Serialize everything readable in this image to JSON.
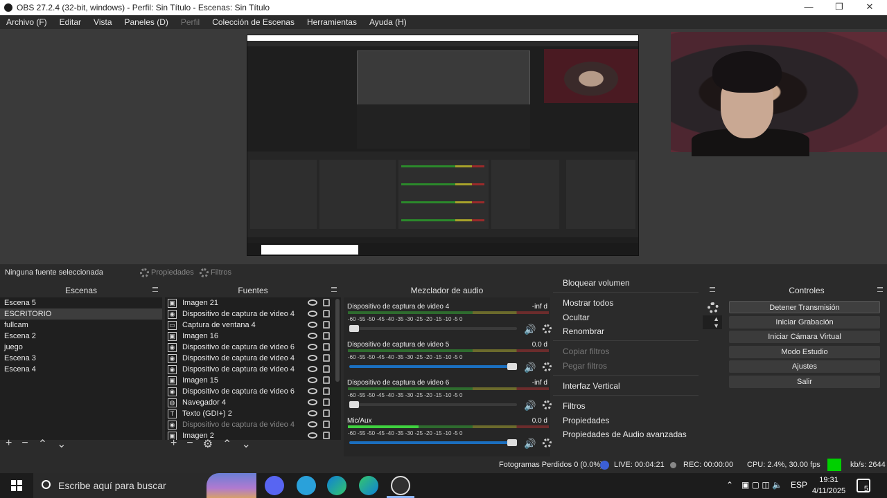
{
  "window": {
    "title": "OBS 27.2.4 (32-bit, windows) - Perfil: Sin Título - Escenas: Sin Título",
    "controls": {
      "minimize": "—",
      "maximize": "❐",
      "close": "✕"
    }
  },
  "menu": [
    "Archivo (F)",
    "Editar",
    "Vista",
    "Paneles (D)",
    "Perfil",
    "Colección de Escenas",
    "Herramientas",
    "Ayuda (H)"
  ],
  "source_toolbar": {
    "status": "Ninguna fuente seleccionada",
    "properties_label": "Propiedades",
    "filters_label": "Filtros"
  },
  "scenes": {
    "title": "Escenas",
    "items": [
      "Escena 5",
      "ESCRITORIO",
      "fullcam",
      "Escena 2",
      "juego",
      "Escena 3",
      "Escena 4"
    ],
    "selected_index": 1
  },
  "sources": {
    "title": "Fuentes",
    "items": [
      {
        "name": "Imagen 21",
        "icon": "image-icon"
      },
      {
        "name": "Dispositivo de captura de video 4",
        "icon": "camera-icon"
      },
      {
        "name": "Captura de ventana 4",
        "icon": "window-icon"
      },
      {
        "name": "Imagen 16",
        "icon": "image-icon"
      },
      {
        "name": "Dispositivo de captura de video 6",
        "icon": "camera-icon"
      },
      {
        "name": "Dispositivo de captura de video 4",
        "icon": "camera-icon"
      },
      {
        "name": "Dispositivo de captura de video 4",
        "icon": "camera-icon"
      },
      {
        "name": "Imagen 15",
        "icon": "image-icon"
      },
      {
        "name": "Dispositivo de captura de video 6",
        "icon": "camera-icon"
      },
      {
        "name": "Navegador 4",
        "icon": "globe-icon"
      },
      {
        "name": "Texto (GDI+) 2",
        "icon": "text-icon"
      },
      {
        "name": "Dispositivo de captura de video 4",
        "icon": "camera-icon",
        "hidden": true
      },
      {
        "name": "Imagen 2",
        "icon": "image-icon"
      }
    ]
  },
  "mixer": {
    "title": "Mezclador de audio",
    "ticks": "-60  -55  -50  -45  -40  -35  -30  -25  -20  -15  -10  -5   0",
    "channels": [
      {
        "name": "Dispositivo de captura de video 4",
        "db": "-inf d",
        "level": 0,
        "volume": 0.05
      },
      {
        "name": "Dispositivo de captura de video 5",
        "db": "0.0 d",
        "level": 0,
        "volume": 1.0
      },
      {
        "name": "Dispositivo de captura de video 6",
        "db": "-inf d",
        "level": 0,
        "volume": 0.05
      },
      {
        "name": "Mic/Aux",
        "db": "0.0 d",
        "level": 0.35,
        "volume": 1.0
      }
    ]
  },
  "context_menu": {
    "items": [
      "Bloquear volumen",
      "Mostrar todos",
      "Ocultar",
      "Renombrar",
      "Copiar filtros",
      "Pegar filtros",
      "Interfaz Vertical",
      "Filtros",
      "Propiedades",
      "Propiedades de Audio avanzadas"
    ],
    "disabled": [
      "Copiar filtros",
      "Pegar filtros"
    ]
  },
  "controls": {
    "title": "Controles",
    "buttons": [
      "Detener Transmisión",
      "Iniciar Grabación",
      "Iniciar Cámara Virtual",
      "Modo Estudio",
      "Ajustes",
      "Salir"
    ]
  },
  "status": {
    "dropped": "Fotogramas Perdidos 0 (0.0%)",
    "live": "LIVE: 00:04:21",
    "rec": "REC: 00:00:00",
    "cpu": "CPU: 2.4%, 30.00 fps",
    "kbps": "kb/s: 2644"
  },
  "taskbar": {
    "search_placeholder": "Escribe aquí para buscar",
    "language": "ESP",
    "time": "19:31",
    "date": "4/11/2025",
    "notifications": "5"
  },
  "colors": {
    "accent": "#1b6fbf",
    "live_indicator": "#00d000",
    "panel": "#2b2b2b"
  }
}
